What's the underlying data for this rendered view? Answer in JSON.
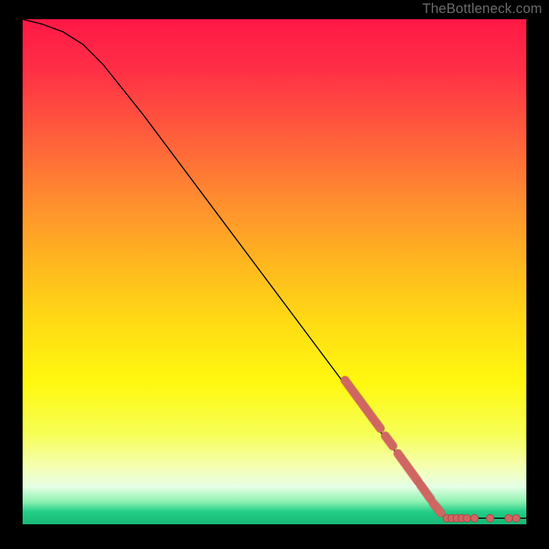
{
  "watermark": "TheBottleneck.com",
  "chart_data": {
    "type": "line",
    "title": "",
    "xlabel": "",
    "ylabel": "",
    "x_range": [
      0,
      100
    ],
    "y_range": [
      0,
      100
    ],
    "curve": [
      {
        "x": 0,
        "y": 100
      },
      {
        "x": 4,
        "y": 99
      },
      {
        "x": 8,
        "y": 97.5
      },
      {
        "x": 12,
        "y": 95
      },
      {
        "x": 16,
        "y": 91
      },
      {
        "x": 20,
        "y": 86
      },
      {
        "x": 24,
        "y": 81
      },
      {
        "x": 30,
        "y": 73
      },
      {
        "x": 36,
        "y": 65
      },
      {
        "x": 42,
        "y": 57
      },
      {
        "x": 48,
        "y": 49
      },
      {
        "x": 54,
        "y": 41
      },
      {
        "x": 60,
        "y": 33
      },
      {
        "x": 66,
        "y": 25
      },
      {
        "x": 72,
        "y": 17
      },
      {
        "x": 78,
        "y": 9
      },
      {
        "x": 83,
        "y": 2.2
      },
      {
        "x": 84,
        "y": 1.6
      },
      {
        "x": 86,
        "y": 1.2
      },
      {
        "x": 100,
        "y": 1.2
      }
    ],
    "highlight_segments": [
      {
        "x1": 64,
        "y1": 28.5,
        "x2": 71,
        "y2": 19
      },
      {
        "x1": 72,
        "y1": 17.5,
        "x2": 73.5,
        "y2": 15.5
      },
      {
        "x1": 74.5,
        "y1": 14,
        "x2": 78.5,
        "y2": 8.5
      },
      {
        "x1": 79,
        "y1": 7.8,
        "x2": 81,
        "y2": 5
      },
      {
        "x1": 81.5,
        "y1": 4.2,
        "x2": 83,
        "y2": 2.3
      }
    ],
    "bottom_points": [
      {
        "x": 84.2,
        "y": 1.2
      },
      {
        "x": 85.2,
        "y": 1.2
      },
      {
        "x": 86.2,
        "y": 1.2
      },
      {
        "x": 87.2,
        "y": 1.2
      },
      {
        "x": 88.2,
        "y": 1.2
      },
      {
        "x": 89.7,
        "y": 1.2
      },
      {
        "x": 92.8,
        "y": 1.2
      },
      {
        "x": 96.5,
        "y": 1.2
      },
      {
        "x": 98.0,
        "y": 1.2
      }
    ],
    "colors": {
      "marker": "#d06662",
      "marker_stroke": "#ad4441",
      "curve": "#000000"
    },
    "gradient_stops": [
      {
        "pos": 0.0,
        "color": "#ff1846"
      },
      {
        "pos": 0.1,
        "color": "#ff2f46"
      },
      {
        "pos": 0.22,
        "color": "#ff5a3d"
      },
      {
        "pos": 0.35,
        "color": "#ff8a30"
      },
      {
        "pos": 0.48,
        "color": "#ffb61f"
      },
      {
        "pos": 0.6,
        "color": "#ffdb14"
      },
      {
        "pos": 0.72,
        "color": "#fff80f"
      },
      {
        "pos": 0.82,
        "color": "#f6ff55"
      },
      {
        "pos": 0.885,
        "color": "#f6ffb0"
      },
      {
        "pos": 0.925,
        "color": "#e6ffe6"
      },
      {
        "pos": 0.955,
        "color": "#8ef2b2"
      },
      {
        "pos": 0.975,
        "color": "#22ce86"
      },
      {
        "pos": 1.0,
        "color": "#18b877"
      }
    ]
  }
}
